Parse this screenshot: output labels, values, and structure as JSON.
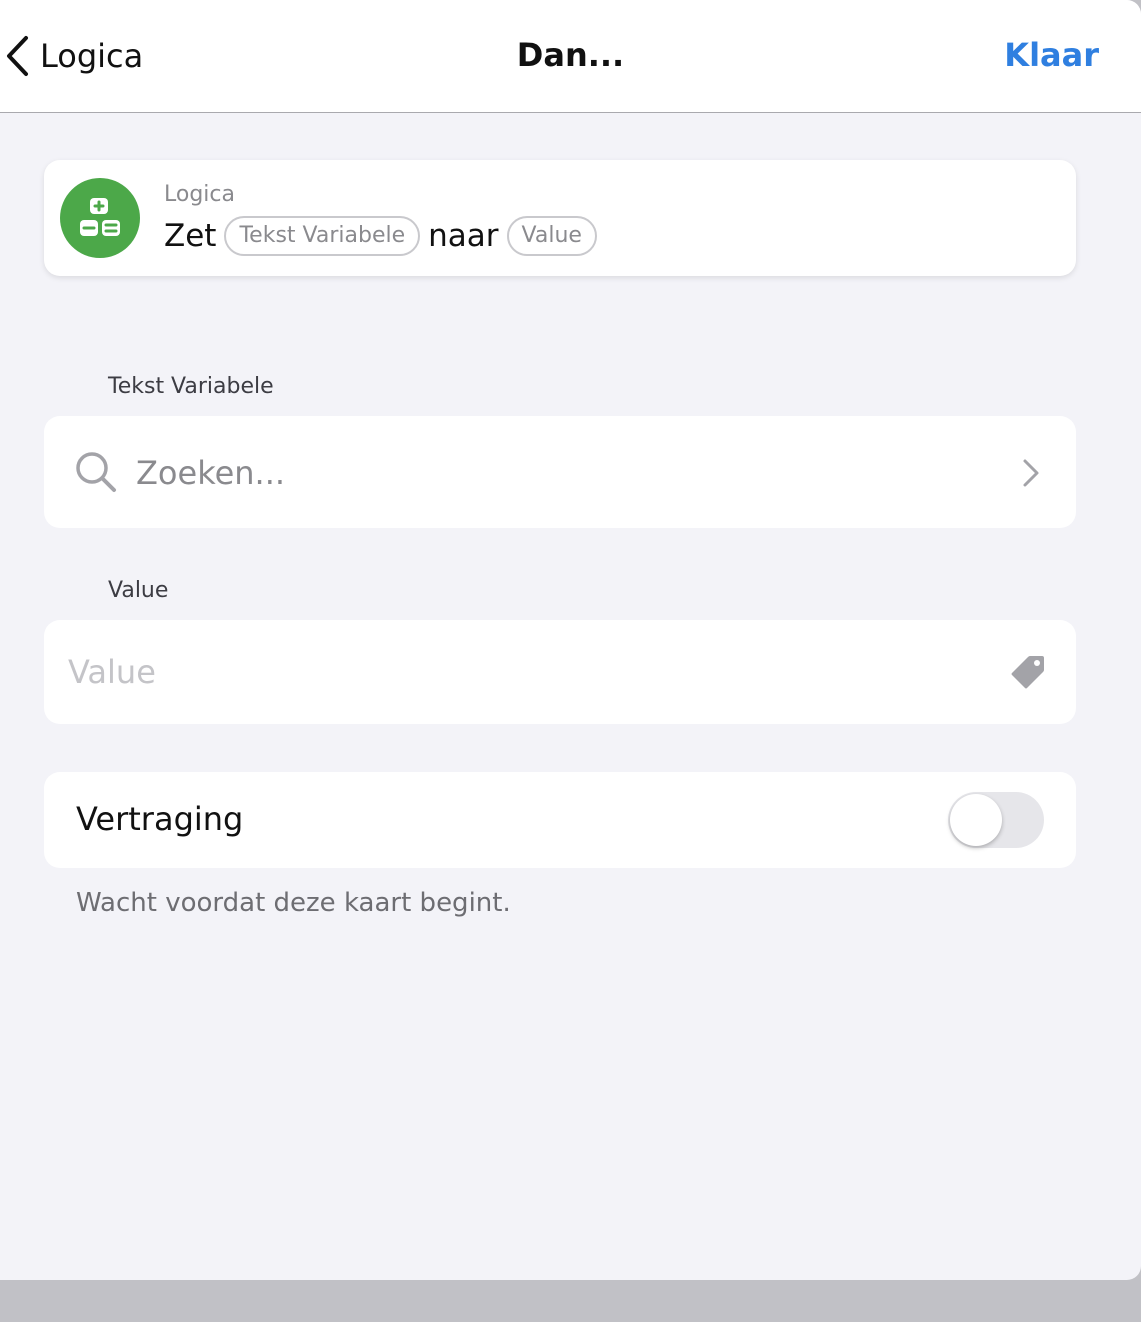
{
  "navbar": {
    "back_label": "Logica",
    "title": "Dan...",
    "done_label": "Klaar"
  },
  "summary": {
    "category": "Logica",
    "word_set": "Zet",
    "pill_variable": "Tekst Variabele",
    "word_to": "naar",
    "pill_value": "Value",
    "icon": "calculator-icon",
    "icon_color": "#4ca849"
  },
  "variable_section": {
    "label": "Tekst Variabele",
    "search_placeholder": "Zoeken..."
  },
  "value_section": {
    "label": "Value",
    "input_value": "",
    "input_placeholder": "Value"
  },
  "delay": {
    "label": "Vertraging",
    "enabled": false,
    "description": "Wacht voordat deze kaart begint."
  },
  "colors": {
    "accent": "#2f7fe0",
    "background": "#f3f3f8"
  }
}
